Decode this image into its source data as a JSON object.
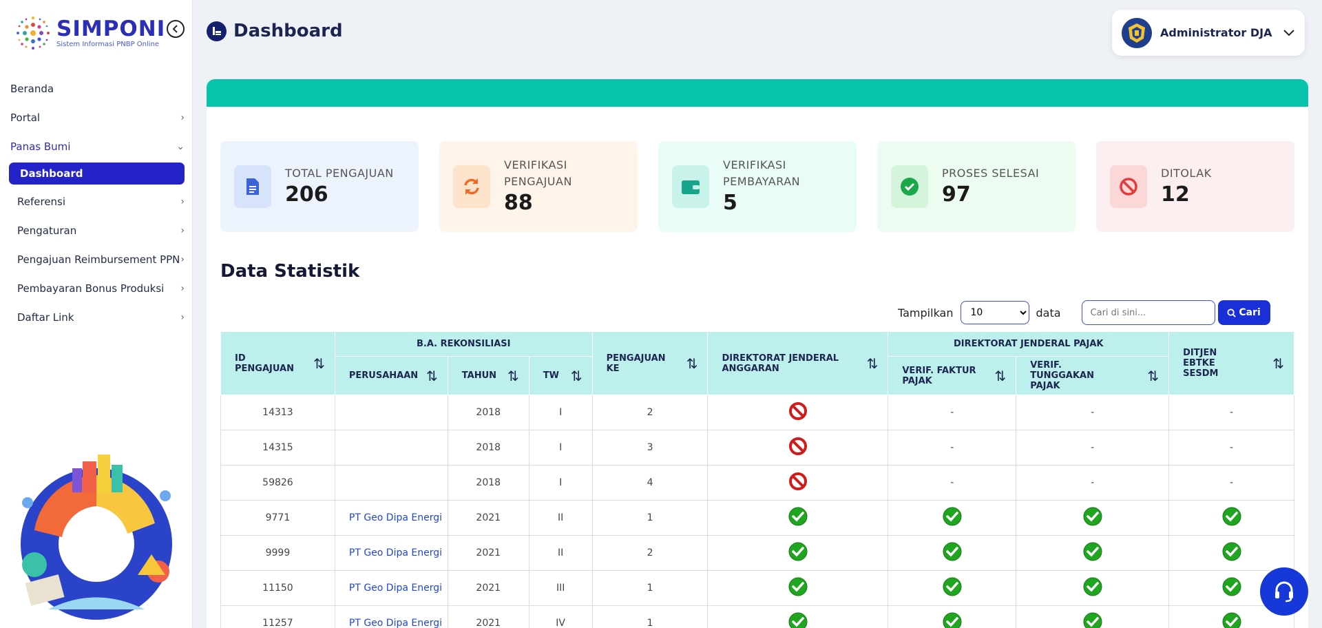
{
  "app": {
    "logo_title": "SIMPONI",
    "logo_subtitle": "Sistem Informasi PNBP Online"
  },
  "sidebar": {
    "items": [
      {
        "label": "Beranda",
        "has_chevron": false
      },
      {
        "label": "Portal",
        "has_chevron": true
      },
      {
        "label": "Panas Bumi",
        "has_chevron": true,
        "open": true
      }
    ],
    "sub_active": "Dashboard",
    "sub_items": [
      {
        "label": "Referensi"
      },
      {
        "label": "Pengaturan"
      },
      {
        "label": "Pengajuan Reimbursement PPN"
      },
      {
        "label": "Pembayaran Bonus Produksi"
      },
      {
        "label": "Daftar Link"
      }
    ]
  },
  "header": {
    "title": "Dashboard",
    "user_name": "Administrator DJA"
  },
  "stats": [
    {
      "label": "TOTAL PENGAJUAN",
      "value": "206",
      "icon": "document-icon",
      "bg": "#edf3fd",
      "icon_bg": "#d6e3fb",
      "icon_color": "#3b64d8"
    },
    {
      "label": "VERIFIKASI PENGAJUAN",
      "value": "88",
      "icon": "refresh-icon",
      "bg": "#fef4ea",
      "icon_bg": "#fde3cc",
      "icon_color": "#ee6c22"
    },
    {
      "label": "VERIFIKASI PEMBAYARAN",
      "value": "5",
      "icon": "wallet-icon",
      "bg": "#eafcf8",
      "icon_bg": "#c9f3ea",
      "icon_color": "#18a58c"
    },
    {
      "label": "PROSES SELESAI",
      "value": "97",
      "icon": "check-circle-icon",
      "bg": "#edfcf0",
      "icon_bg": "#d4f5dc",
      "icon_color": "#19a84a"
    },
    {
      "label": "DITOLAK",
      "value": "12",
      "icon": "ban-icon",
      "bg": "#fdefef",
      "icon_bg": "#fbd7d7",
      "icon_color": "#e23c3c"
    }
  ],
  "section": {
    "title": "Data Statistik",
    "show_label": "Tampilkan",
    "show_value": "10",
    "show_options": [
      "10"
    ],
    "data_label": "data",
    "search_placeholder": "Cari di sini...",
    "search_button": "Cari"
  },
  "table": {
    "headers": {
      "id": "ID PENGAJUAN",
      "ba": "B.A. REKONSILIASI",
      "perusahaan": "PERUSAHAAN",
      "tahun": "TAHUN",
      "tw": "TW",
      "pengajuan_ke": "PENGAJUAN KE",
      "dja": "DIREKTORAT JENDERAL ANGGARAN",
      "djp": "DIREKTORAT JENDERAL PAJAK",
      "verif_faktur": "VERIF. FAKTUR PAJAK",
      "verif_tunggakan": "VERIF. TUNGGAKAN PAJAK",
      "ebtke": "DITJEN EBTKE SESDM"
    },
    "rows": [
      {
        "id": "14313",
        "perusahaan": "",
        "tahun": "2018",
        "tw": "I",
        "ke": "2",
        "dja": "rejected",
        "faktur": "-",
        "tunggakan": "-",
        "ebtke": "-"
      },
      {
        "id": "14315",
        "perusahaan": "",
        "tahun": "2018",
        "tw": "I",
        "ke": "3",
        "dja": "rejected",
        "faktur": "-",
        "tunggakan": "-",
        "ebtke": "-"
      },
      {
        "id": "59826",
        "perusahaan": "",
        "tahun": "2018",
        "tw": "I",
        "ke": "4",
        "dja": "rejected",
        "faktur": "-",
        "tunggakan": "-",
        "ebtke": "-"
      },
      {
        "id": "9771",
        "perusahaan": "PT Geo Dipa Energi",
        "tahun": "2021",
        "tw": "II",
        "ke": "1",
        "dja": "approved",
        "faktur": "approved",
        "tunggakan": "approved",
        "ebtke": "approved"
      },
      {
        "id": "9999",
        "perusahaan": "PT Geo Dipa Energi",
        "tahun": "2021",
        "tw": "II",
        "ke": "2",
        "dja": "approved",
        "faktur": "approved",
        "tunggakan": "approved",
        "ebtke": "approved"
      },
      {
        "id": "11150",
        "perusahaan": "PT Geo Dipa Energi",
        "tahun": "2021",
        "tw": "III",
        "ke": "1",
        "dja": "approved",
        "faktur": "approved",
        "tunggakan": "approved",
        "ebtke": "approved"
      },
      {
        "id": "11257",
        "perusahaan": "PT Geo Dipa Energi",
        "tahun": "2021",
        "tw": "IV",
        "ke": "1",
        "dja": "approved",
        "faktur": "approved",
        "tunggakan": "approved",
        "ebtke": "approved"
      }
    ]
  },
  "colors": {
    "accent": "#2323c8",
    "teal": "#08c3ac",
    "header_bg": "#bdf0ec"
  }
}
